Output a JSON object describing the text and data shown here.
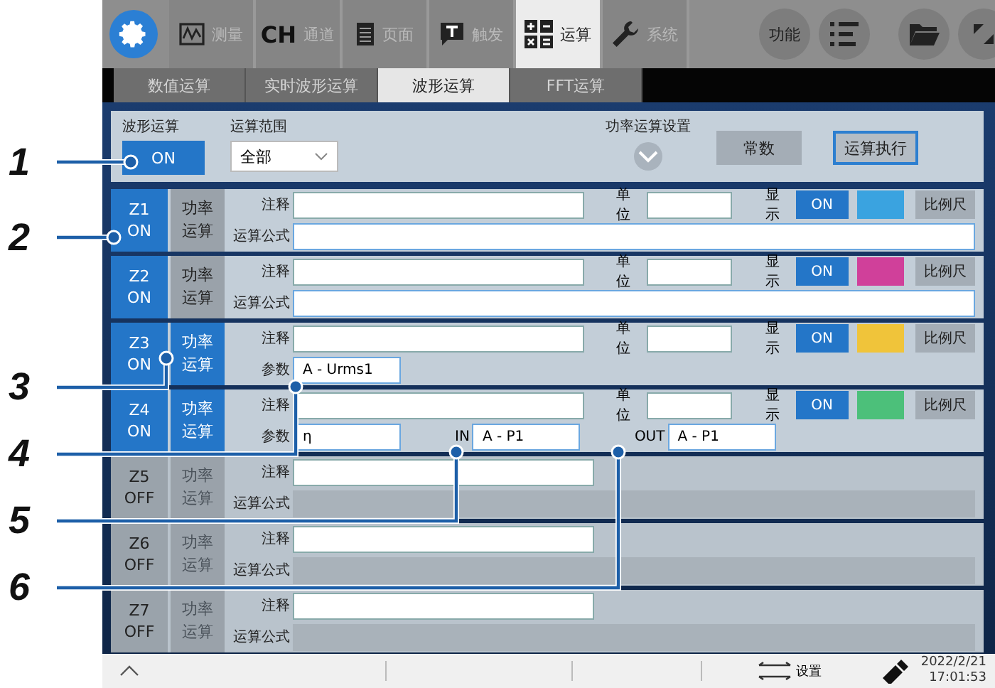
{
  "top_tabs": [
    {
      "kind": "wave",
      "label": "测量",
      "selected": false
    },
    {
      "kind": "ch",
      "icon_text": "CH",
      "label": "通道",
      "selected": false
    },
    {
      "kind": "page",
      "label": "页面",
      "selected": false
    },
    {
      "kind": "trigger",
      "label": "触发",
      "selected": false
    },
    {
      "kind": "calc",
      "label": "运算",
      "selected": true
    },
    {
      "kind": "wrench",
      "label": "系统",
      "selected": false
    }
  ],
  "round_buttons": [
    {
      "kind": "text",
      "label": "功能"
    },
    {
      "kind": "list"
    },
    {
      "kind": "folder"
    },
    {
      "kind": "expand"
    }
  ],
  "sub_tabs": [
    {
      "label": "数值运算",
      "selected": false
    },
    {
      "label": "实时波形运算",
      "selected": false
    },
    {
      "label": "波形运算",
      "selected": true
    },
    {
      "label": "FFT运算",
      "selected": false
    }
  ],
  "panel": {
    "waveform_label": "波形运算",
    "waveform_value": "ON",
    "waveform_on": true,
    "range_label": "运算范围",
    "range_value": "全部",
    "power_settings": "功率运算设置",
    "constants_button": "常数",
    "execute_button": "运算执行"
  },
  "rows": [
    {
      "id": "Z1",
      "state": "ON",
      "on": true,
      "type": "功率运算",
      "kind": "formula",
      "note_label": "注释",
      "unit_label": "单位",
      "display_label": "显示",
      "display_value": "ON",
      "color": "#3aa3e0",
      "scale_button": "比例尺",
      "formula_label": "运算公式"
    },
    {
      "id": "Z2",
      "state": "ON",
      "on": true,
      "type": "功率运算",
      "kind": "formula",
      "note_label": "注释",
      "unit_label": "单位",
      "display_label": "显示",
      "display_value": "ON",
      "color": "#d0409a",
      "scale_button": "比例尺",
      "formula_label": "运算公式"
    },
    {
      "id": "Z3",
      "state": "ON",
      "on": true,
      "type": "功率运算",
      "kind": "param",
      "note_label": "注释",
      "unit_label": "单位",
      "display_label": "显示",
      "display_value": "ON",
      "color": "#f0c43a",
      "scale_button": "比例尺",
      "param_label": "参数",
      "param_value": "A - Urms1"
    },
    {
      "id": "Z4",
      "state": "ON",
      "on": true,
      "type": "功率运算",
      "kind": "efficiency",
      "note_label": "注释",
      "unit_label": "单位",
      "display_label": "显示",
      "display_value": "ON",
      "color": "#4cc07a",
      "scale_button": "比例尺",
      "param_label": "参数",
      "param_value": "η",
      "in_label": "IN",
      "in_value": "A - P1",
      "out_label": "OUT",
      "out_value": "A - P1"
    },
    {
      "id": "Z5",
      "state": "OFF",
      "on": false,
      "type": "功率运算",
      "kind": "formula",
      "note_label": "注释",
      "formula_label": "运算公式"
    },
    {
      "id": "Z6",
      "state": "OFF",
      "on": false,
      "type": "功率运算",
      "kind": "formula",
      "note_label": "注释",
      "formula_label": "运算公式"
    },
    {
      "id": "Z7",
      "state": "OFF",
      "on": false,
      "type": "功率运算",
      "kind": "formula",
      "note_label": "注释",
      "formula_label": "运算公式"
    }
  ],
  "status_bar": {
    "settings_label": "设置",
    "date": "2022/2/21",
    "time": "17:01:53"
  },
  "callouts": [
    "1",
    "2",
    "3",
    "4",
    "5",
    "6"
  ]
}
